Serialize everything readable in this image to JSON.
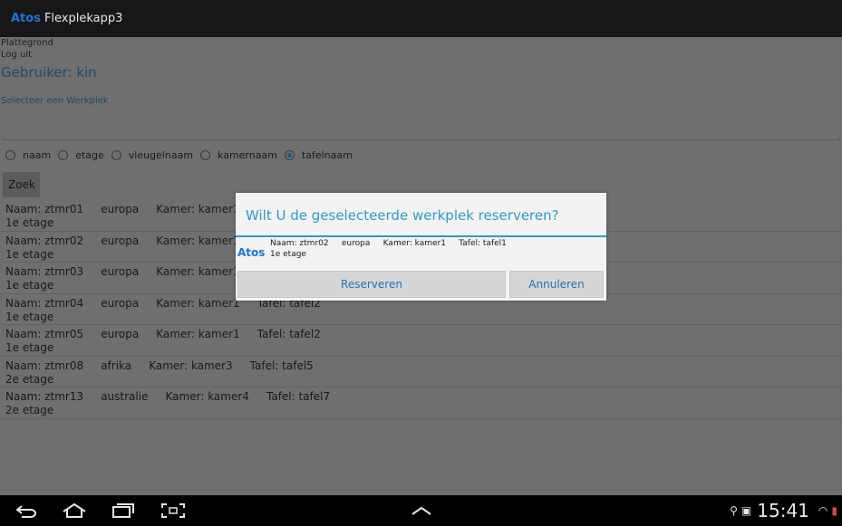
{
  "app": {
    "logo": "Atos",
    "title": "Flexplekapp3"
  },
  "menu": {
    "plattegrond": "Plattegrond",
    "loguit": "Log uit"
  },
  "user_label": "Gebruiker: kin",
  "select_label": "Selecteer een Werkplek",
  "search_input": {
    "value": ""
  },
  "radio_options": [
    {
      "label": "naam",
      "checked": false
    },
    {
      "label": "etage",
      "checked": false
    },
    {
      "label": "vleugelnaam",
      "checked": false
    },
    {
      "label": "kamernaam",
      "checked": false
    },
    {
      "label": "tafelnaam",
      "checked": true
    }
  ],
  "search_button": "Zoek",
  "rows": [
    {
      "line1": "Naam: ztmr01     europa     Kamer: kamer1",
      "line2": "1e etage"
    },
    {
      "line1": "Naam: ztmr02     europa     Kamer: kamer1",
      "line2": "1e etage"
    },
    {
      "line1": "Naam: ztmr03     europa     Kamer: kamer1",
      "line2": "1e etage"
    },
    {
      "line1": "Naam: ztmr04     europa     Kamer: kamer1     Tafel: tafel2",
      "line2": "1e etage"
    },
    {
      "line1": "Naam: ztmr05     europa     Kamer: kamer1     Tafel: tafel2",
      "line2": "1e etage"
    },
    {
      "line1": "Naam: ztmr08     afrika     Kamer: kamer3     Tafel: tafel5",
      "line2": "2e etage"
    },
    {
      "line1": "Naam: ztmr13     australie     Kamer: kamer4     Tafel: tafel7",
      "line2": "2e etage"
    }
  ],
  "dialog": {
    "title": "Wilt U de geselecteerde werkplek reserveren?",
    "logo": "Atos",
    "line1": "Naam: ztmr02     europa     Kamer: kamer1     Tafel: tafel1",
    "line2": "1e etage",
    "reserve": "Reserveren",
    "cancel": "Annuleren"
  },
  "status": {
    "time": "15:41"
  },
  "nav_icons": [
    "back-icon",
    "home-icon",
    "recent-apps-icon",
    "screenshot-icon",
    "chevron-up-icon"
  ],
  "colors": {
    "accent": "#2d9cc4",
    "brand": "#1f74d8"
  }
}
